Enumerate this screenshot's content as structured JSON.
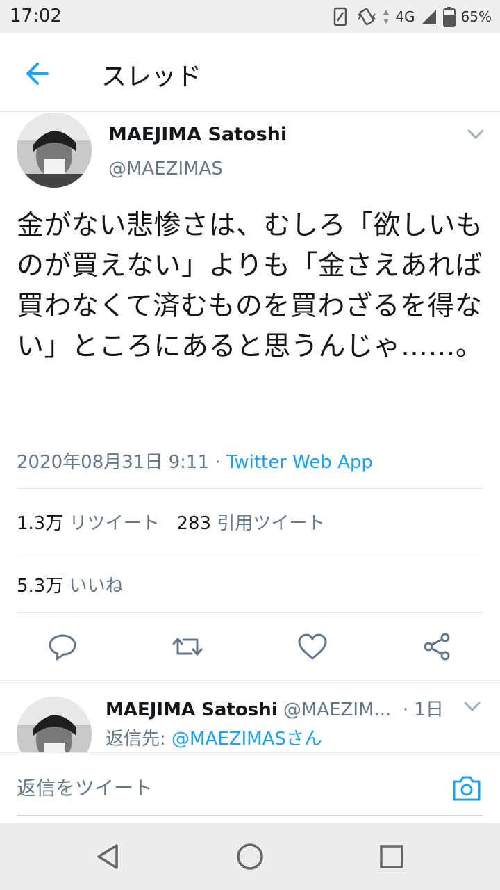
{
  "status_bar": {
    "time": "17:02",
    "network": "4G",
    "battery": "65%"
  },
  "header": {
    "title": "スレッド"
  },
  "tweet": {
    "display_name": "MAEJIMA Satoshi",
    "handle": "@MAEZIMAS",
    "text": "金がない悲惨さは、むしろ「欲しいものが買えない」よりも「金さえあれば買わなくて済むものを買わざるを得ない」ところにあると思うんじゃ……。",
    "timestamp": "2020年08月31日 9:11 · ",
    "source": "Twitter Web App",
    "retweet_count": "1.3万",
    "retweet_label": "リツイート",
    "quote_count": "283",
    "quote_label": "引用ツイート",
    "like_count": "5.3万",
    "like_label": "いいね"
  },
  "actions": {
    "icons": [
      "reply-icon",
      "retweet-icon",
      "like-icon",
      "share-icon"
    ]
  },
  "reply": {
    "display_name": "MAEJIMA Satoshi",
    "handle": "@MAEZIM...",
    "time": "· 1日",
    "replying_to_label": "返信先: ",
    "replying_to_handle": "@MAEZIMASさん"
  },
  "compose": {
    "placeholder": "返信をツイート"
  },
  "colors": {
    "accent": "#1da1f2",
    "secondary_text": "#657786",
    "divider": "#e1e8ed"
  }
}
